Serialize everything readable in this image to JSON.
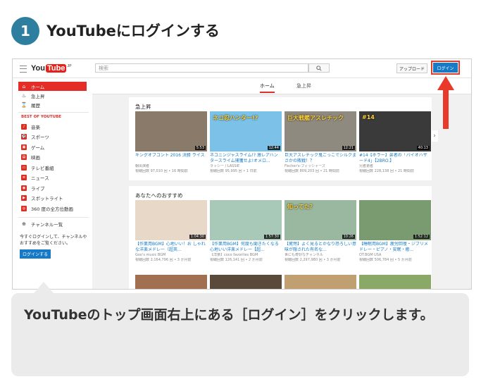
{
  "step": {
    "number": "1",
    "title": "YouTubeにログインする"
  },
  "youtube": {
    "logo": {
      "you": "You",
      "tube": "Tube",
      "region": "JP"
    },
    "search_placeholder": "検索",
    "upload_label": "アップロード",
    "login_label": "ログイン",
    "sidebar": {
      "items": [
        {
          "label": "ホーム",
          "icon": "home-icon",
          "glyph": "⌂"
        },
        {
          "label": "急上昇",
          "icon": "fire-icon",
          "glyph": "♨"
        },
        {
          "label": "履歴",
          "icon": "hourglass-icon",
          "glyph": "⌛"
        }
      ],
      "section_title": "BEST OF YOUTUBE",
      "best": [
        {
          "label": "音楽",
          "icon": "music-icon",
          "glyph": "♪"
        },
        {
          "label": "スポーツ",
          "icon": "sports-icon",
          "glyph": "⚽"
        },
        {
          "label": "ゲーム",
          "icon": "game-icon",
          "glyph": "▣"
        },
        {
          "label": "映画",
          "icon": "film-icon",
          "glyph": "▤"
        },
        {
          "label": "テレビ番組",
          "icon": "tv-icon",
          "glyph": "▭"
        },
        {
          "label": "ニュース",
          "icon": "news-icon",
          "glyph": "≡"
        },
        {
          "label": "ライブ",
          "icon": "live-icon",
          "glyph": "◉"
        },
        {
          "label": "スポットライト",
          "icon": "spotlight-icon",
          "glyph": "▶"
        },
        {
          "label": "360 度の全方位動画",
          "icon": "360-icon",
          "glyph": "◎"
        }
      ],
      "channels": {
        "label": "チャンネル一覧",
        "icon": "plus-circle-icon",
        "glyph": "⊕"
      },
      "signin_text": "今すぐログインして、チャンネルやおすすめをご覧ください。",
      "signin_button": "ログインする"
    },
    "tabs": [
      "ホーム",
      "急上昇"
    ],
    "trending": {
      "title": "急上昇",
      "videos": [
        {
          "title": "キングオブコント 2016 決勝 ライス",
          "channel": "朝出演者",
          "meta": "視聴回数 97,010 回 • 16 時間前",
          "duration": "5:53",
          "color": "#8a7a6a",
          "overlay": ""
        },
        {
          "title": "ネコニンジャスライム!? 激レアハンタースライム捕獲せよ!オメロ...",
          "channel": "ラッシー / LASSIE",
          "meta": "視聴回数 95,995 回 • 1 日前",
          "duration": "12:44",
          "color": "#7cc2e8",
          "overlay": "ネコ忍ハンター!?"
        },
        {
          "title": "巨大アスレチック鬼ごっこでシルクまさかの敗戦！？",
          "channel": "Fischer's-フィッシャーズ",
          "meta": "視聴回数 809,203 回 • 21 時間前",
          "duration": "12:21",
          "color": "#8f8a80",
          "overlay": "巨大戦艦アスレチック"
        },
        {
          "title": "#14【ホラー】弟者の「バイオハザード4」【2BRO.】",
          "channel": "兄者弟者",
          "meta": "視聴回数 228,138 回 • 21 時間前",
          "duration": "40:13",
          "color": "#3a3a3a",
          "overlay": "#14"
        }
      ]
    },
    "recommended": {
      "title": "あなたへのおすすめ",
      "videos": [
        {
          "title": "【作業用BGM】心地いい！お しゃれな洋楽メドレー（超英...",
          "channel": "Goo's music BGM",
          "meta": "視聴回数 2,164,796 回 • 3 か月前",
          "duration": "1:04:30",
          "color": "#e8d8c8",
          "overlay": ""
        },
        {
          "title": "【作業用BGM】何度も聞きたくなる心地いい洋楽メドレー【超...",
          "channel": "【洋楽】coco favorites BGM",
          "meta": "視聴回数 126,141 回 • 2 か月前",
          "duration": "1:57:30",
          "color": "#a8c8b8",
          "overlay": ""
        },
        {
          "title": "【驚愕】よく見るとかなり恐ろしい意味が隠された有名な...",
          "channel": "世にも奇妙なチャンネル",
          "meta": "視聴回数 2,297,980 回 • 3 か月前",
          "duration": "10:26",
          "color": "#9ab8a0",
          "overlay": "知ってた？"
        },
        {
          "title": "【睡眠用BGM】疲労回復・ジブリメドレー・ピアノ・安眠・癒...",
          "channel": "OT.BGM USA",
          "meta": "視聴回数 506,784 回 • 5 か月前",
          "duration": "1:52:12",
          "color": "#7a9a70",
          "overlay": ""
        }
      ]
    },
    "bottom_row_colors": [
      "#a07050",
      "#5a4a3a",
      "#c0a070",
      "#8aa868"
    ]
  },
  "caption": "YouTubeのトップ画面右上にある［ログイン］をクリックします。",
  "colors": {
    "accent": "#2e7ea0",
    "youtube_red": "#e52d27",
    "login_blue": "#167ac6",
    "arrow_red": "#e8392a",
    "bubble": "#ebebeb"
  }
}
